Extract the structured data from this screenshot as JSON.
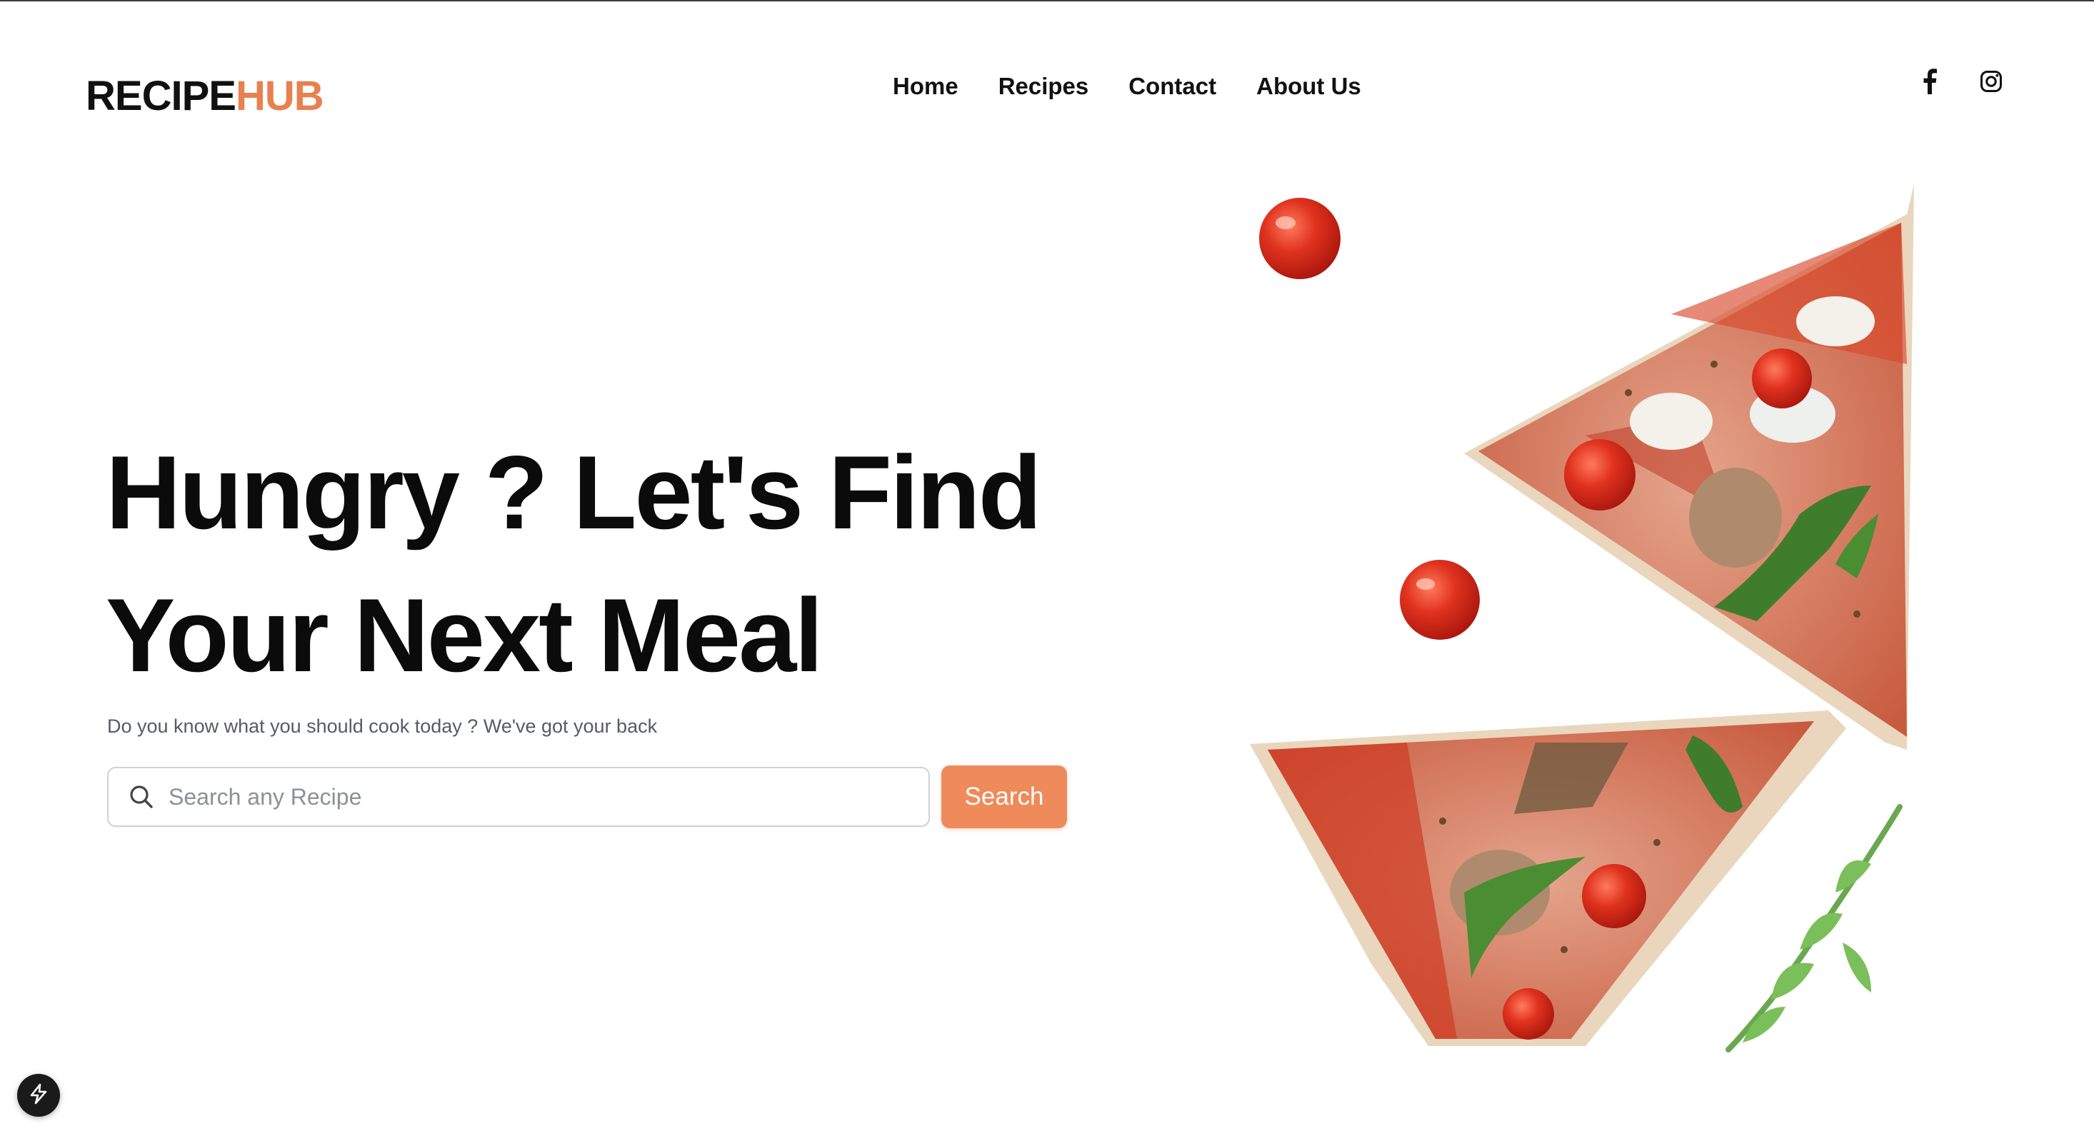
{
  "header": {
    "logo_part1": "RECIPE",
    "logo_part2": "HUB",
    "nav": [
      {
        "label": "Home"
      },
      {
        "label": "Recipes"
      },
      {
        "label": "Contact"
      },
      {
        "label": "About Us"
      }
    ],
    "social_icons": [
      "facebook-icon",
      "instagram-icon"
    ]
  },
  "hero": {
    "title_line1": "Hungry ? Let's Find",
    "title_line2": "Your Next Meal",
    "subtitle": "Do you know what you should cook today ? We've got your back",
    "search_placeholder": "Search any Recipe",
    "search_value": "",
    "search_button": "Search"
  },
  "colors": {
    "accent": "#ef8a5a",
    "logo_accent": "#e8804f",
    "text": "#111111",
    "muted": "#555b66"
  },
  "images": {
    "hero_art": "pizza-slices-with-tomatoes-and-arugula"
  }
}
